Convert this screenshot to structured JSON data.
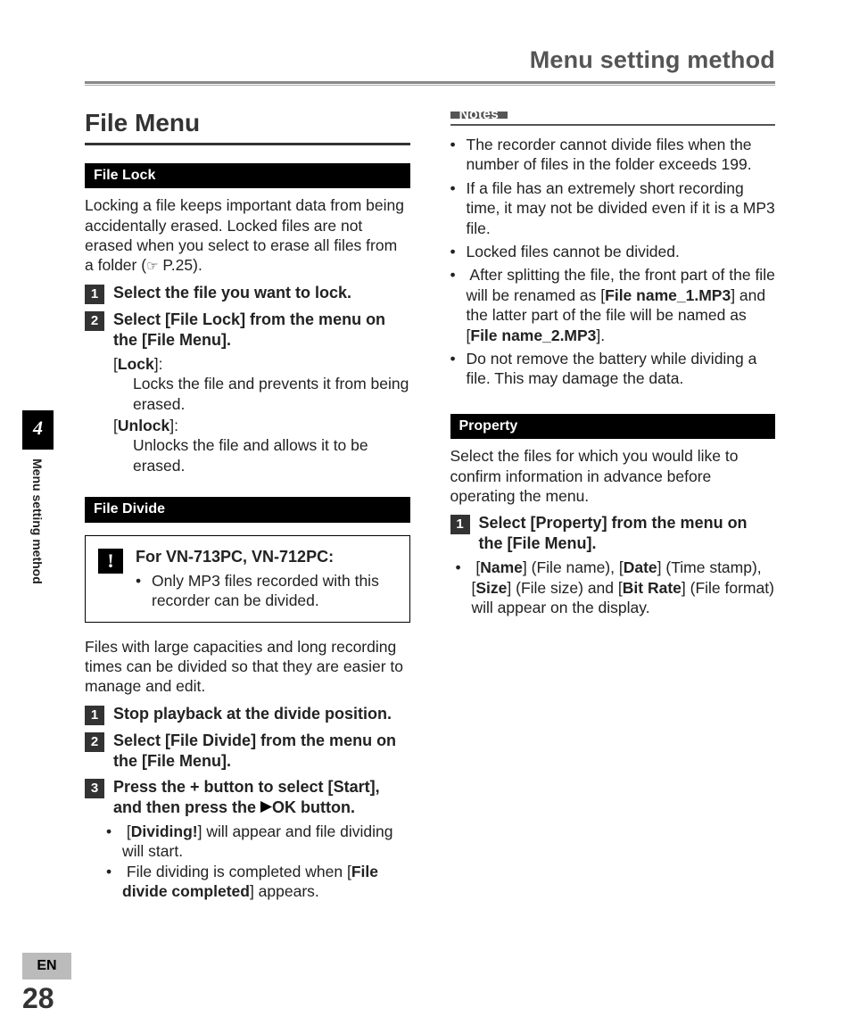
{
  "header": {
    "title": "Menu setting method"
  },
  "sideTab": {
    "chapter": "4",
    "label": "Menu setting method"
  },
  "lang": "EN",
  "pageNumber": "28",
  "left": {
    "sectionTitle": "File Menu",
    "fileLock": {
      "header": "File Lock",
      "intro_pre": "Locking a file keeps important data from being accidentally erased. Locked files are not erased when you select to erase all files from a folder (",
      "intro_ref": " P.25).",
      "step1": "Select the file you want to lock.",
      "step2_pre": "Select [",
      "step2_b1": "File Lock",
      "step2_mid": "] from the menu on the [",
      "step2_b2": "File Menu",
      "step2_post": "].",
      "lock_label": "[Lock]:",
      "lock_desc": "Locks the file and prevents it from being erased.",
      "unlock_label": "[Unlock]:",
      "unlock_desc": "Unlocks the file and allows it to be erased."
    },
    "fileDivide": {
      "header": "File Divide",
      "warnTitle": "For VN-713PC, VN-712PC:",
      "warnItem": "Only MP3 files recorded with this recorder can be divided.",
      "intro": "Files with large capacities and long recording times can be divided so that they are easier to manage and edit.",
      "step1": "Stop playback at the divide position.",
      "step2_pre": "Select [",
      "step2_b1": "File Divide",
      "step2_mid": "] from the menu on the [",
      "step2_b2": "File Menu",
      "step2_post": "].",
      "step3_pre": "Press the + button to select [",
      "step3_b1": "Start",
      "step3_mid": "], and then press the ",
      "step3_b2": "OK",
      "step3_post": " button.",
      "b1_pre": "[",
      "b1_b": "Dividing!",
      "b1_post": "] will appear and file dividing will start.",
      "b2_pre": "File dividing is completed when [",
      "b2_b": "File divide completed",
      "b2_post": "] appears."
    }
  },
  "right": {
    "notes": {
      "header": "Notes",
      "n1": "The recorder cannot divide files when the number of files in the folder exceeds 199.",
      "n2": "If a file has an extremely short recording time, it may not be divided even if it is a MP3 file.",
      "n3": "Locked files cannot be divided.",
      "n4_pre": "After splitting the file, the front part of the file will be renamed as [",
      "n4_b1": "File name_1.MP3",
      "n4_mid": "] and the latter part of the file will be named as [",
      "n4_b2": "File name_2.MP3",
      "n4_post": "].",
      "n5": "Do not remove the battery while dividing a file. This may damage the data."
    },
    "property": {
      "header": "Property",
      "intro": "Select the files for which you would like to confirm information in advance before operating the menu.",
      "step1_pre": "Select [",
      "step1_b1": "Property",
      "step1_mid": "] from the menu on the [",
      "step1_b2": "File Menu",
      "step1_post": "].",
      "b_pre": "[",
      "b_name": "Name",
      "b_t1": "] (File name), [",
      "b_date": "Date",
      "b_t2": "] (Time stamp), [",
      "b_size": "Size",
      "b_t3": "] (File size) and [",
      "b_bit": "Bit Rate",
      "b_post": "] (File format) will appear on the display."
    }
  }
}
